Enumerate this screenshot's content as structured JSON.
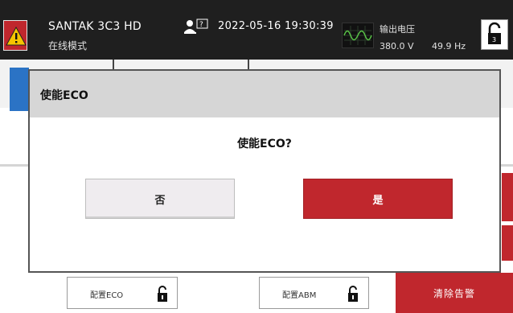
{
  "header": {
    "device_name": "SANTAK 3C3 HD",
    "mode": "在线模式",
    "datetime": "2022-05-16 19:30:39",
    "output_label": "输出电压",
    "output_voltage": "380.0 V",
    "output_frequency": "49.9 Hz",
    "user_help": "?"
  },
  "dialog": {
    "title": "使能ECO",
    "question": "使能ECO?",
    "no_label": "否",
    "yes_label": "是"
  },
  "bottom": {
    "config_eco_label": "配置ECO",
    "config_abm_label": "配置ABM",
    "clear_alarm_label": "清除告警"
  },
  "colors": {
    "header_bg": "#1f1f1f",
    "alarm_red": "#c0272d",
    "accent_blue": "#2b73c5",
    "dialog_title_bg": "#d6d6d6"
  },
  "icons": [
    "warning-icon",
    "user-help-icon",
    "sine-wave-icon",
    "lock-icon"
  ]
}
